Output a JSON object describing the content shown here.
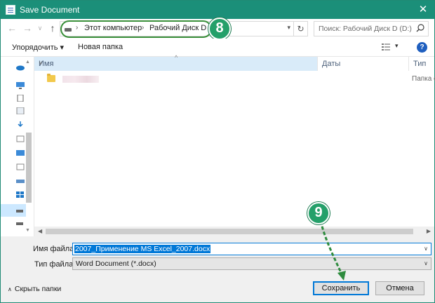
{
  "window": {
    "title": "Save Document",
    "close_glyph": "✕"
  },
  "navigation": {
    "back_glyph": "←",
    "forward_glyph": "→",
    "recent_glyph": "∨",
    "up_glyph": "↑",
    "breadcrumb": [
      "Этот компьютер",
      "Рабочий Диск D (D:)"
    ],
    "breadcrumb_sep": "›",
    "refresh_glyph": "↻",
    "search_placeholder": "Поиск: Рабочий Диск D (D:)"
  },
  "toolbar": {
    "organize_label": "Упорядочить ▾",
    "new_folder_label": "Новая папка",
    "view_dropdown_glyph": "▾",
    "help_glyph": "?"
  },
  "file_list": {
    "columns": [
      "Имя",
      "Даты",
      "Тип"
    ],
    "sort_glyph": "^",
    "rows": [
      {
        "type": "Папка с"
      }
    ]
  },
  "form": {
    "file_name_label": "Имя файла:",
    "file_name_value": "2007_Применение MS Excel_2007.docx",
    "file_type_label": "Тип файла:",
    "file_type_value": "Word Document (*.docx)"
  },
  "footer": {
    "hide_folders_label": "Скрыть папки",
    "save_label": "Сохранить",
    "cancel_label": "Отмена"
  },
  "callouts": [
    "8",
    "9"
  ],
  "colors": {
    "titlebar": "#1b8f79",
    "accent": "#0078d7",
    "callout_badge": "#24a06a",
    "callout_line": "#3a8f3a"
  }
}
